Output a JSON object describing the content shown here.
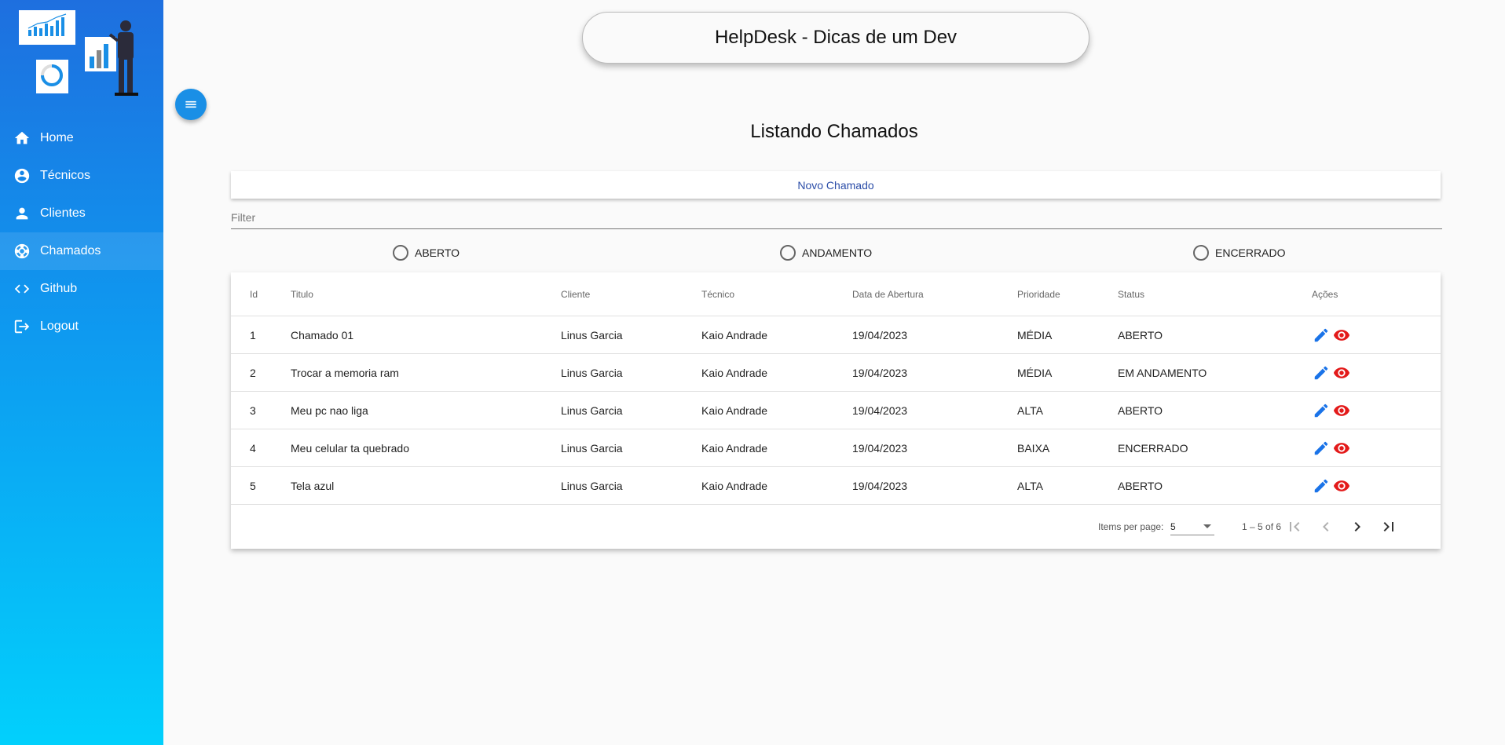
{
  "header": {
    "title": "HelpDesk - Dicas de um Dev"
  },
  "sidebar": {
    "items": [
      {
        "label": "Home",
        "icon": "home-icon"
      },
      {
        "label": "Técnicos",
        "icon": "account-circle-icon"
      },
      {
        "label": "Clientes",
        "icon": "person-icon"
      },
      {
        "label": "Chamados",
        "icon": "support-icon",
        "active": true
      },
      {
        "label": "Github",
        "icon": "code-icon"
      },
      {
        "label": "Logout",
        "icon": "logout-icon"
      }
    ]
  },
  "main": {
    "title": "Listando Chamados",
    "new_button": "Novo Chamado",
    "filter_placeholder": "Filter",
    "status_filters": [
      "ABERTO",
      "ANDAMENTO",
      "ENCERRADO"
    ]
  },
  "table": {
    "columns": [
      "Id",
      "Titulo",
      "Cliente",
      "Técnico",
      "Data de Abertura",
      "Prioridade",
      "Status",
      "Ações"
    ],
    "rows": [
      {
        "id": "1",
        "titulo": "Chamado 01",
        "cliente": "Linus Garcia",
        "tecnico": "Kaio Andrade",
        "data": "19/04/2023",
        "prioridade": "MÉDIA",
        "status": "ABERTO"
      },
      {
        "id": "2",
        "titulo": "Trocar a memoria ram",
        "cliente": "Linus Garcia",
        "tecnico": "Kaio Andrade",
        "data": "19/04/2023",
        "prioridade": "MÉDIA",
        "status": "EM ANDAMENTO"
      },
      {
        "id": "3",
        "titulo": "Meu pc nao liga",
        "cliente": "Linus Garcia",
        "tecnico": "Kaio Andrade",
        "data": "19/04/2023",
        "prioridade": "ALTA",
        "status": "ABERTO"
      },
      {
        "id": "4",
        "titulo": "Meu celular ta quebrado",
        "cliente": "Linus Garcia",
        "tecnico": "Kaio Andrade",
        "data": "19/04/2023",
        "prioridade": "BAIXA",
        "status": "ENCERRADO"
      },
      {
        "id": "5",
        "titulo": "Tela azul",
        "cliente": "Linus Garcia",
        "tecnico": "Kaio Andrade",
        "data": "19/04/2023",
        "prioridade": "ALTA",
        "status": "ABERTO"
      }
    ]
  },
  "paginator": {
    "items_per_page_label": "Items per page:",
    "page_size": "5",
    "range": "1 – 5 of 6"
  },
  "colors": {
    "sidebar_top": "#1e6fdf",
    "sidebar_bottom": "#02d0fc",
    "edit_icon": "#1a73e8",
    "view_icon": "#e31a1a",
    "link_text": "#2b4da8"
  }
}
